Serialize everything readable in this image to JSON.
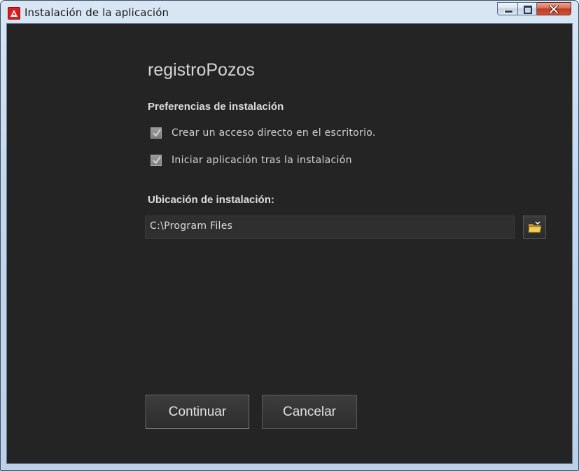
{
  "window": {
    "title": "Instalación de la aplicación",
    "app_icon": "adobe-air-icon",
    "controls": {
      "minimize": "minimize-icon",
      "maximize": "maximize-icon",
      "close": "close-icon"
    }
  },
  "app": {
    "name": "registroPozos"
  },
  "preferences": {
    "heading": "Preferencias de instalación",
    "options": [
      {
        "label": "Crear un acceso directo en el escritorio.",
        "checked": true
      },
      {
        "label": "Iniciar aplicación tras la instalación",
        "checked": true
      }
    ]
  },
  "location": {
    "heading": "Ubicación de instalación:",
    "path": "C:\\Program Files",
    "browse_icon": "folder-icon"
  },
  "buttons": {
    "continue": "Continuar",
    "cancel": "Cancelar"
  },
  "colors": {
    "background": "#242424",
    "text": "#d4d4d4",
    "close_button": "#c1391f"
  }
}
